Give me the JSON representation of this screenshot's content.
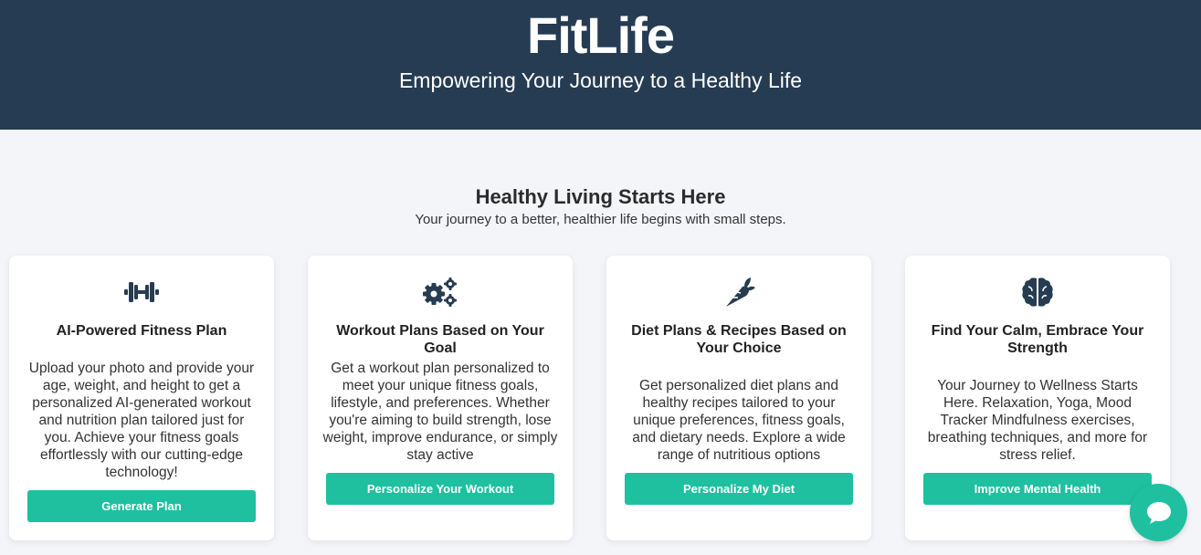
{
  "hero": {
    "title": "FitLife",
    "subtitle": "Empowering Your Journey to a Healthy Life"
  },
  "intro": {
    "title": "Healthy Living Starts Here",
    "subtitle": "Your journey to a better, healthier life begins with small steps."
  },
  "cards": [
    {
      "icon": "dumbbell-icon",
      "title": "AI-Powered Fitness Plan",
      "description": "Upload your photo and provide your age, weight, and height to get a personalized AI-generated workout and nutrition plan tailored just for you. Achieve your fitness goals effortlessly with our cutting-edge technology!",
      "button": "Generate Plan"
    },
    {
      "icon": "gears-icon",
      "title": "Workout Plans Based on Your Goal",
      "description": "Get a workout plan personalized to meet your unique fitness goals, lifestyle, and preferences. Whether you're aiming to build strength, lose weight, improve endurance, or simply stay active",
      "button": "Personalize Your Workout"
    },
    {
      "icon": "carrot-icon",
      "title": "Diet Plans & Recipes Based on Your Choice",
      "description": "Get personalized diet plans and healthy recipes tailored to your unique preferences, fitness goals, and dietary needs. Explore a wide range of nutritious options",
      "button": "Personalize My Diet"
    },
    {
      "icon": "brain-icon",
      "title": "Find Your Calm, Embrace Your Strength",
      "description": "Your Journey to Wellness Starts Here. Relaxation, Yoga, Mood Tracker Mindfulness exercises, breathing techniques, and more for stress relief.",
      "button": "Improve Mental Health"
    }
  ],
  "chat": {
    "icon": "chat-bubble-icon"
  },
  "colors": {
    "hero_bg": "#263c52",
    "accent": "#1ec0a0",
    "page_bg": "#f4f5f9",
    "icon": "#263c52"
  }
}
